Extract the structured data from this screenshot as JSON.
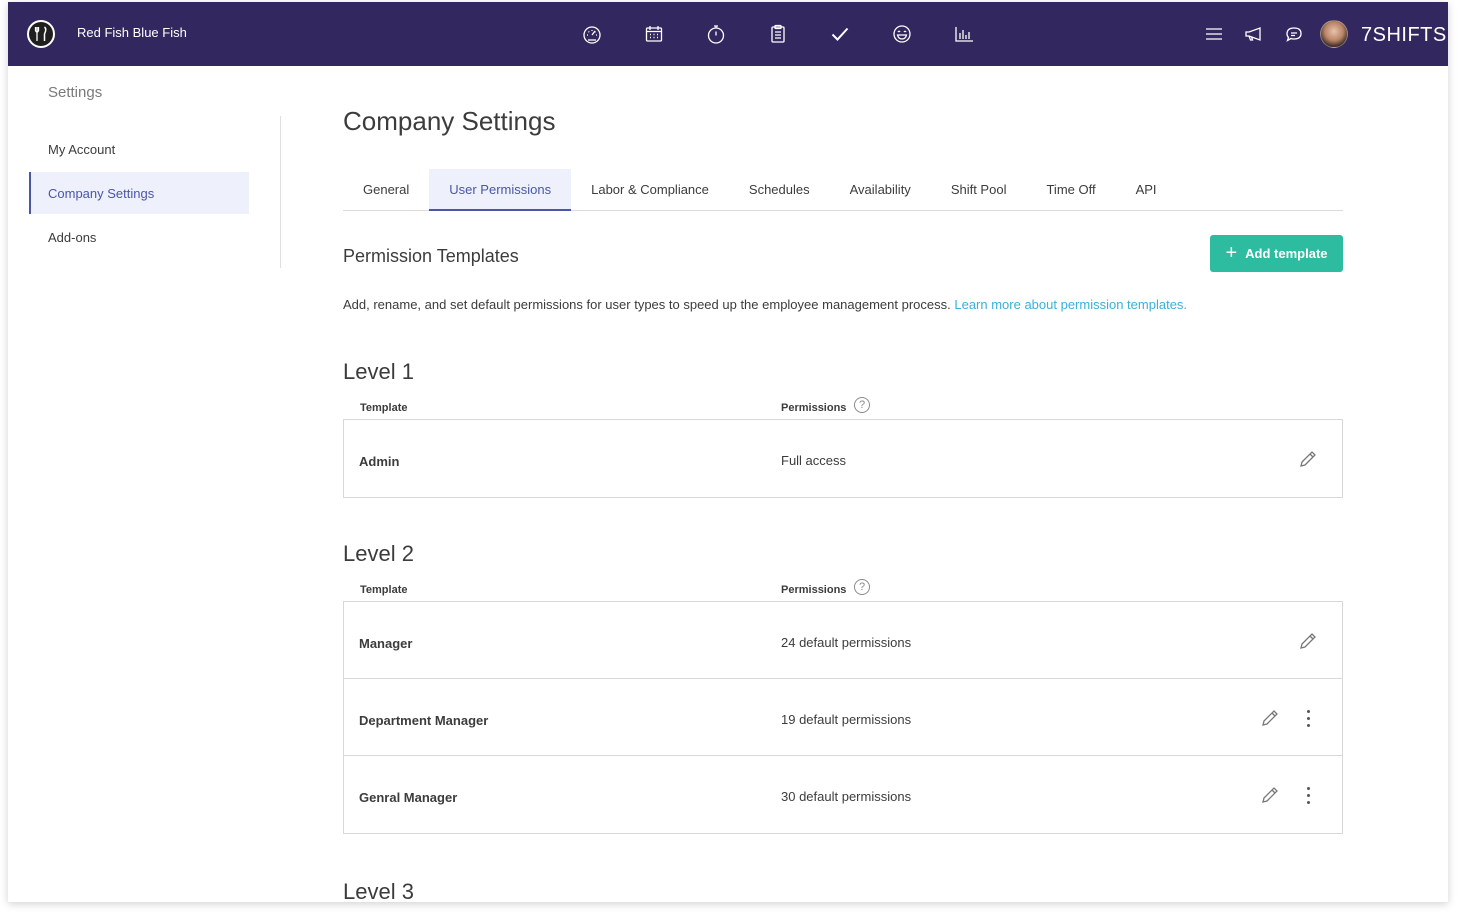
{
  "topbar": {
    "company_name": "Red Fish Blue Fish",
    "brand": "7SHIFTS",
    "nav_icons": [
      "dashboard-icon",
      "calendar-icon",
      "stopwatch-icon",
      "clipboard-icon",
      "checkmark-icon",
      "smiley-icon",
      "bar-chart-icon"
    ],
    "right_icons": [
      "menu-lines-icon",
      "megaphone-icon",
      "chat-bubble-icon"
    ],
    "bg_color": "#32285f"
  },
  "sidebar": {
    "title": "Settings",
    "items": [
      {
        "label": "My Account",
        "active": false
      },
      {
        "label": "Company Settings",
        "active": true
      },
      {
        "label": "Add-ons",
        "active": false
      }
    ]
  },
  "main": {
    "title": "Company Settings",
    "tabs": [
      {
        "label": "General",
        "active": false
      },
      {
        "label": "User Permissions",
        "active": true
      },
      {
        "label": "Labor & Compliance",
        "active": false
      },
      {
        "label": "Schedules",
        "active": false
      },
      {
        "label": "Availability",
        "active": false
      },
      {
        "label": "Shift Pool",
        "active": false
      },
      {
        "label": "Time Off",
        "active": false
      },
      {
        "label": "API",
        "active": false
      }
    ],
    "section_title": "Permission Templates",
    "add_button": "Add template",
    "description": "Add, rename, and set default permissions for user types to speed up the employee management process.",
    "learn_more": "Learn more about permission templates.",
    "accent_color": "#2ebca0",
    "link_color": "#3bb0d8"
  },
  "columns": {
    "template": "Template",
    "permissions": "Permissions",
    "help": "?"
  },
  "levels": [
    {
      "title": "Level 1",
      "rows": [
        {
          "template": "Admin",
          "permissions": "Full access",
          "menu": false
        }
      ]
    },
    {
      "title": "Level 2",
      "rows": [
        {
          "template": "Manager",
          "permissions": "24 default permissions",
          "menu": false
        },
        {
          "template": "Department Manager",
          "permissions": "19 default permissions",
          "menu": true
        },
        {
          "template": "Genral Manager",
          "permissions": "30 default permissions",
          "menu": true
        }
      ]
    },
    {
      "title": "Level 3",
      "rows": []
    }
  ]
}
